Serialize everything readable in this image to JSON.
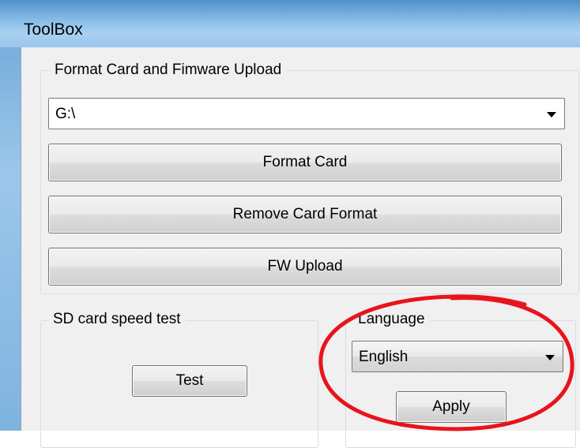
{
  "window": {
    "title": "ToolBox"
  },
  "format_group": {
    "title": "Format Card and Fimware Upload",
    "drive_select": {
      "value": "G:\\"
    },
    "format_button": "Format Card",
    "remove_format_button": "Remove Card Format",
    "fw_upload_button": "FW Upload"
  },
  "speed_group": {
    "title": "SD card speed test",
    "test_button": "Test"
  },
  "language_group": {
    "title": "Language",
    "language_select": {
      "value": "English"
    },
    "apply_button": "Apply"
  },
  "annotation": {
    "color": "#e8141c",
    "shape": "hand-drawn ellipse"
  }
}
